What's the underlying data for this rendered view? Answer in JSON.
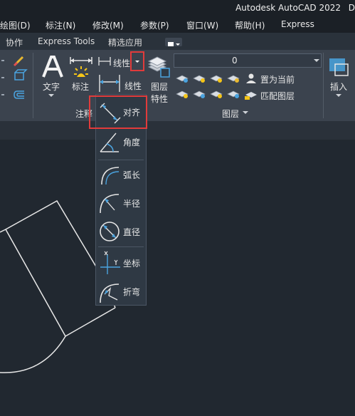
{
  "app_title": "Autodesk AutoCAD 2022",
  "title_cut": "D",
  "menu": [
    "绘图(D)",
    "标注(N)",
    "修改(M)",
    "参数(P)",
    "窗口(W)",
    "帮助(H)",
    "Express"
  ],
  "tabs": [
    "协作",
    "Express Tools",
    "精选应用"
  ],
  "ribbon": {
    "text_label": "文字",
    "dim_label": "标注",
    "linear_label": "线性",
    "linear_label2": "线性",
    "annotation_panel": "注释",
    "layer_props_label1": "图层",
    "layer_props_label2": "特性",
    "layer_value": "0",
    "set_current": "置为当前",
    "match_layer": "匹配图层",
    "layer_panel": "图层",
    "insert_label": "插入"
  },
  "dropdown": {
    "items": [
      "对齐",
      "角度",
      "弧长",
      "半径",
      "直径",
      "坐标",
      "折弯"
    ]
  },
  "colors": {
    "highlight": "#e23b3b",
    "icon_blue": "#4aa3df",
    "bulb_yellow": "#f5c518"
  }
}
